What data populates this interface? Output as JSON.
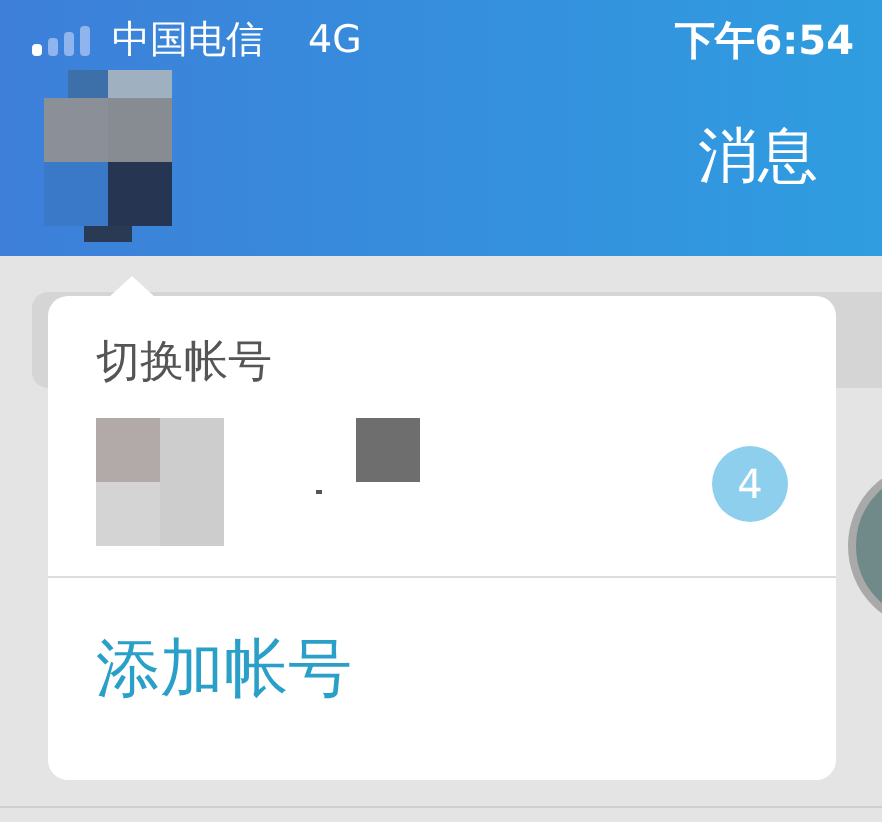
{
  "status_bar": {
    "carrier": "中国电信",
    "network": "4G",
    "time": "下午6:54"
  },
  "header": {
    "title": "消息"
  },
  "account_popup": {
    "title": "切换帐号",
    "accounts": [
      {
        "kind": "picture",
        "badge": "4"
      }
    ],
    "add_button": "添加帐号"
  }
}
